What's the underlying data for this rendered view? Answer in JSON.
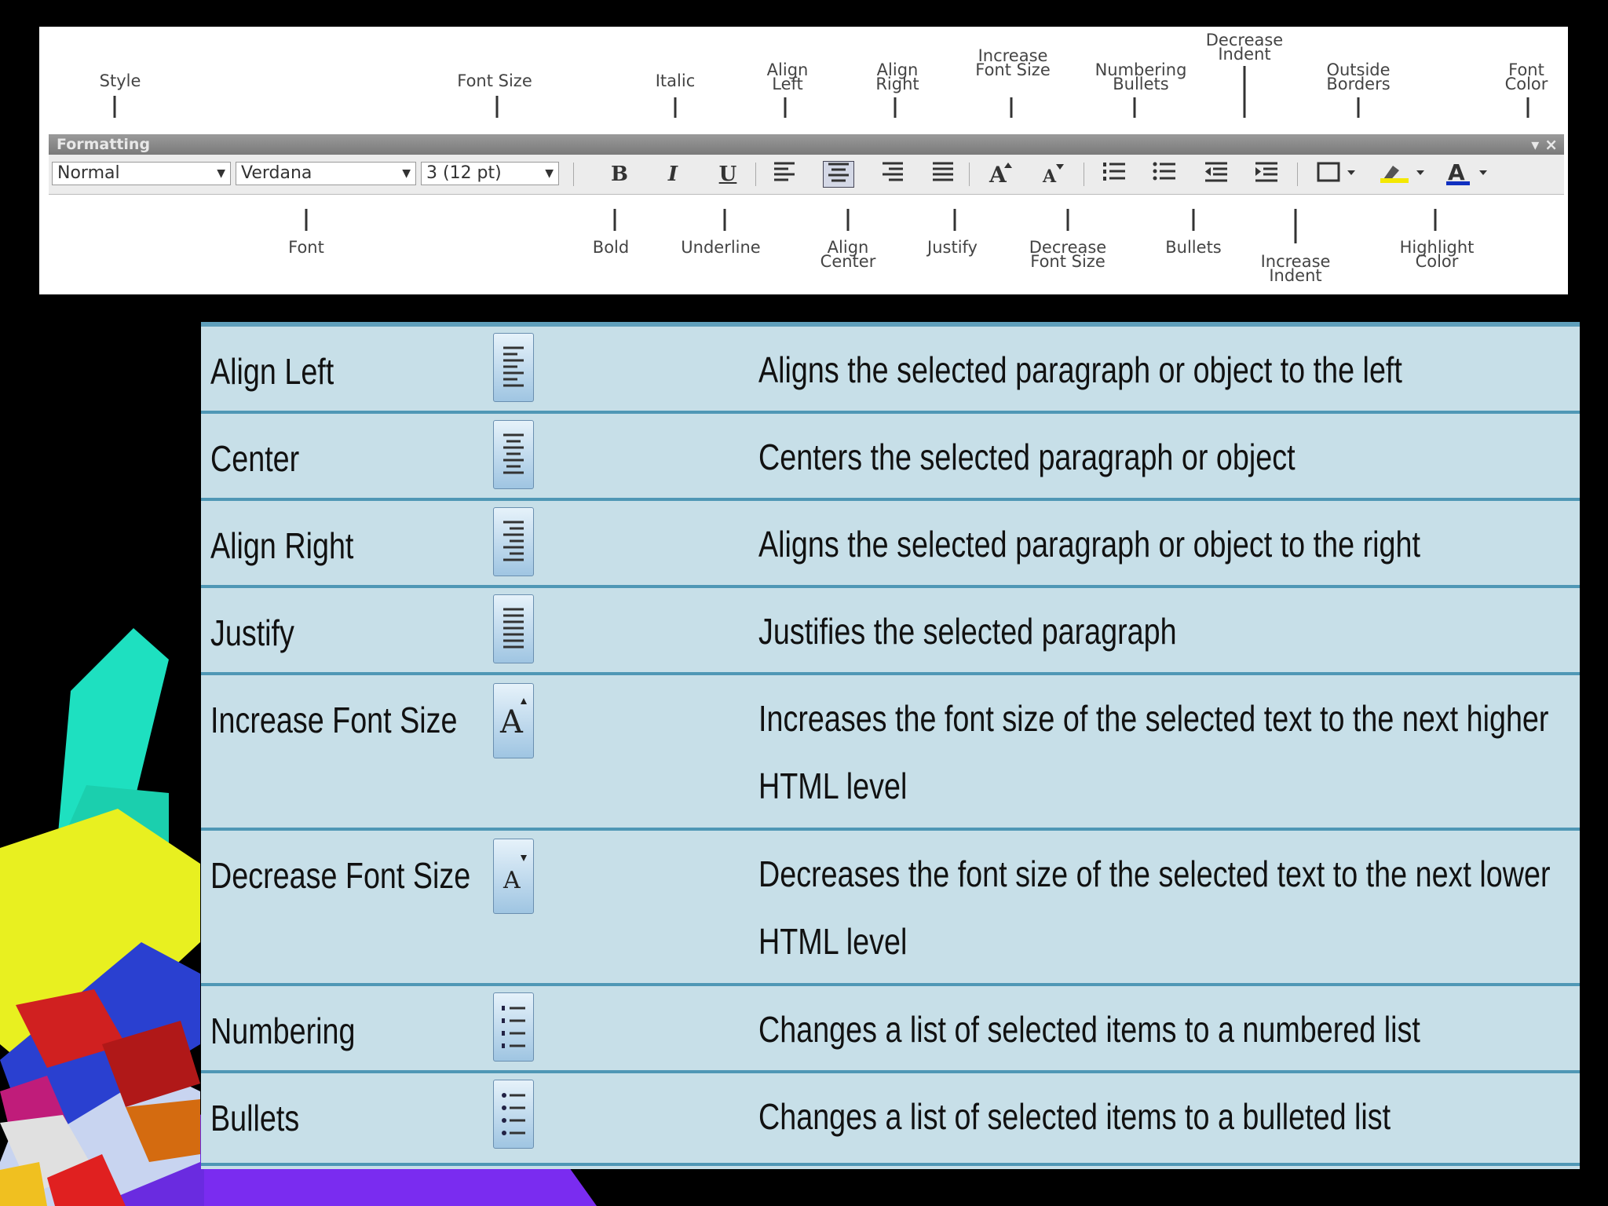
{
  "diagram": {
    "top_callouts": [
      "Style",
      "Font Size",
      "Italic",
      "Align Left",
      "Align Right",
      "Increase Font Size",
      "Numbering Bullets",
      "Decrease Indent",
      "Outside Borders",
      "Font Color"
    ],
    "bottom_callouts": [
      "Font",
      "Bold",
      "Underline",
      "Align Center",
      "Justify",
      "Decrease Font Size",
      "Bullets",
      "Increase Indent",
      "Highlight Color"
    ],
    "toolbar": {
      "title": "Formatting",
      "style_value": "Normal",
      "font_value": "Verdana",
      "size_value": "3 (12 pt)",
      "bold": "B",
      "italic": "I",
      "underline": "U"
    }
  },
  "table": {
    "rows": [
      {
        "command": "Align Left",
        "icon": "align-left-icon",
        "description": "Aligns the selected paragraph or object to the left"
      },
      {
        "command": "Center",
        "icon": "align-center-icon",
        "description": "Centers the selected paragraph or object"
      },
      {
        "command": "Align Right",
        "icon": "align-right-icon",
        "description": "Aligns the selected paragraph or object to the right"
      },
      {
        "command": "Justify",
        "icon": "justify-icon",
        "description": "Justifies the selected paragraph"
      },
      {
        "command": "Increase Font Size",
        "icon": "increase-font-size-icon",
        "description": "Increases the font size of the selected text to the next higher HTML level"
      },
      {
        "command": "Decrease Font Size",
        "icon": "decrease-font-size-icon",
        "description": "Decreases the font size of the selected text to the next lower HTML level"
      },
      {
        "command": "Numbering",
        "icon": "numbering-icon",
        "description": "Changes a list of selected items to a numbered list"
      },
      {
        "command": "Bullets",
        "icon": "bullets-icon",
        "description": "Changes a list of selected items to a bulleted list"
      }
    ]
  },
  "colors": {
    "table_bg": "#c7dfe8",
    "table_rule": "#4f97b5",
    "background": "#000000"
  }
}
